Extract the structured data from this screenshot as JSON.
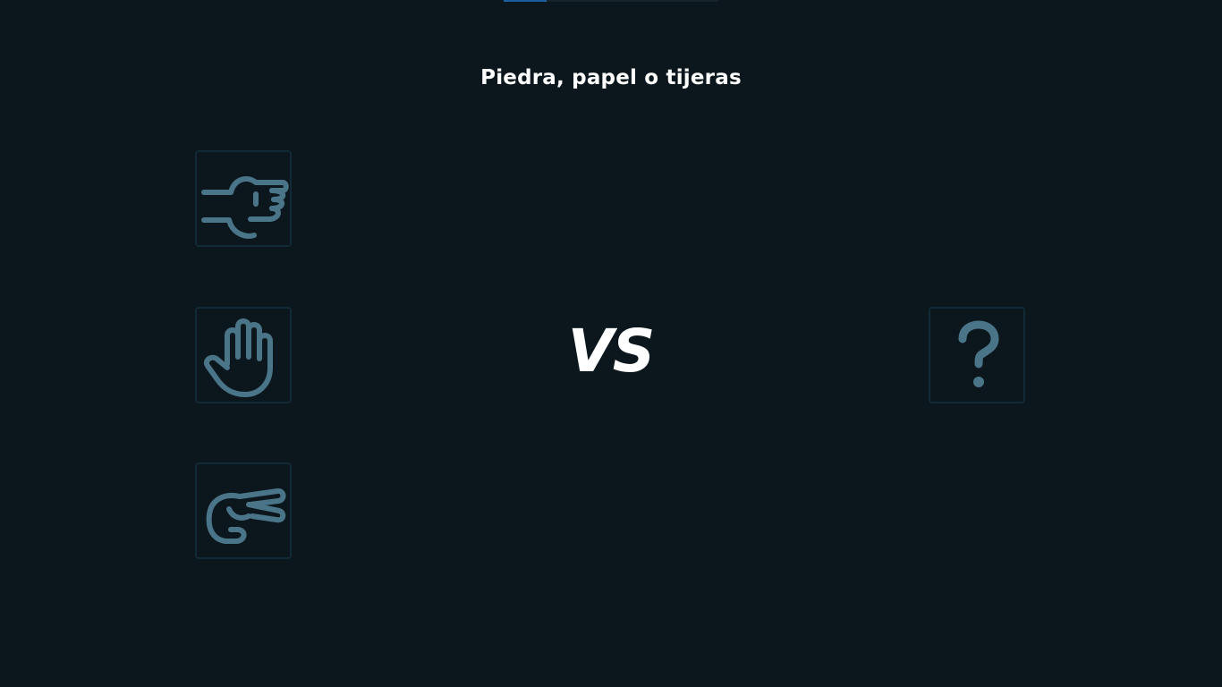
{
  "game": {
    "title": "Piedra, papel o tijeras",
    "vs_label": "VS",
    "choices": [
      {
        "id": "rock",
        "icon": "fist-pointing-right-icon"
      },
      {
        "id": "paper",
        "icon": "open-hand-icon"
      },
      {
        "id": "scissors",
        "icon": "two-fingers-scissors-icon"
      }
    ],
    "opponent": {
      "icon": "question-mark-icon",
      "state": "unknown"
    }
  },
  "colors": {
    "background": "#0c171d",
    "icon": "#4a7588",
    "tile_border": "#112a36",
    "text": "#ffffff",
    "indicator_active": "#1b5f9e"
  }
}
